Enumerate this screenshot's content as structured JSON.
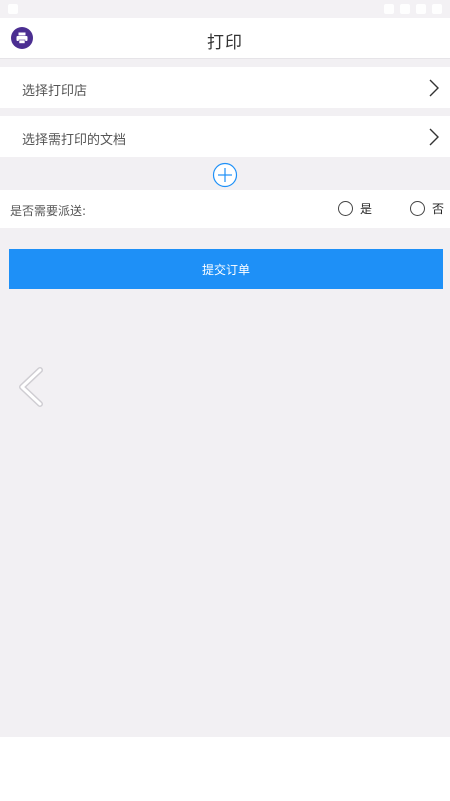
{
  "header": {
    "title": "打印",
    "logo_icon": "printer-icon",
    "logo_color": "#4b2e91"
  },
  "rows": {
    "select_shop": {
      "label": "选择打印店",
      "icon": "chevron-right-icon"
    },
    "select_document": {
      "label": "选择需打印的文档",
      "icon": "chevron-right-icon"
    }
  },
  "add_document": {
    "icon": "plus-circle-icon",
    "color": "#1e90f7"
  },
  "delivery": {
    "label": "是否需要派送:",
    "options": [
      {
        "label": "是",
        "selected": false
      },
      {
        "label": "否",
        "selected": false
      }
    ]
  },
  "submit": {
    "label": "提交订单",
    "color": "#1e90f7"
  },
  "overlay": {
    "back_icon": "chevron-left-icon"
  },
  "colors": {
    "background": "#f2f0f3",
    "accent": "#1e90f7"
  }
}
